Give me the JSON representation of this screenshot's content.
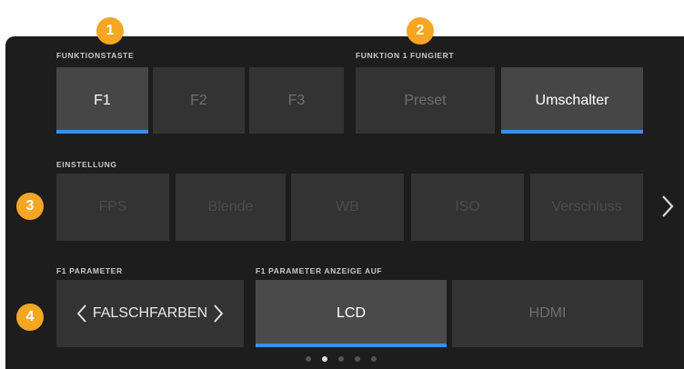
{
  "badges": [
    "1",
    "2",
    "3",
    "4"
  ],
  "sections": {
    "funktionstaste": {
      "label": "FUNKTIONSTASTE",
      "buttons": [
        "F1",
        "F2",
        "F3"
      ],
      "selected": "F1"
    },
    "funktion_fungiert": {
      "label": "FUNKTION 1 FUNGIERT",
      "buttons": [
        "Preset",
        "Umschalter"
      ],
      "selected": "Umschalter"
    },
    "einstellung": {
      "label": "EINSTELLUNG",
      "buttons": [
        "FPS",
        "Blende",
        "WB",
        "ISO",
        "Verschluss"
      ]
    },
    "parameter": {
      "label": "F1 PARAMETER",
      "value": "FALSCHFARBEN"
    },
    "anzeige": {
      "label": "F1 PARAMETER ANZEIGE AUF",
      "buttons": [
        "LCD",
        "HDMI"
      ],
      "selected": "LCD"
    }
  },
  "pagination": {
    "count": 5,
    "current": 2
  },
  "colors": {
    "accent": "#3d8ee6",
    "badge": "#f5a623",
    "background": "#1d1d1d"
  }
}
